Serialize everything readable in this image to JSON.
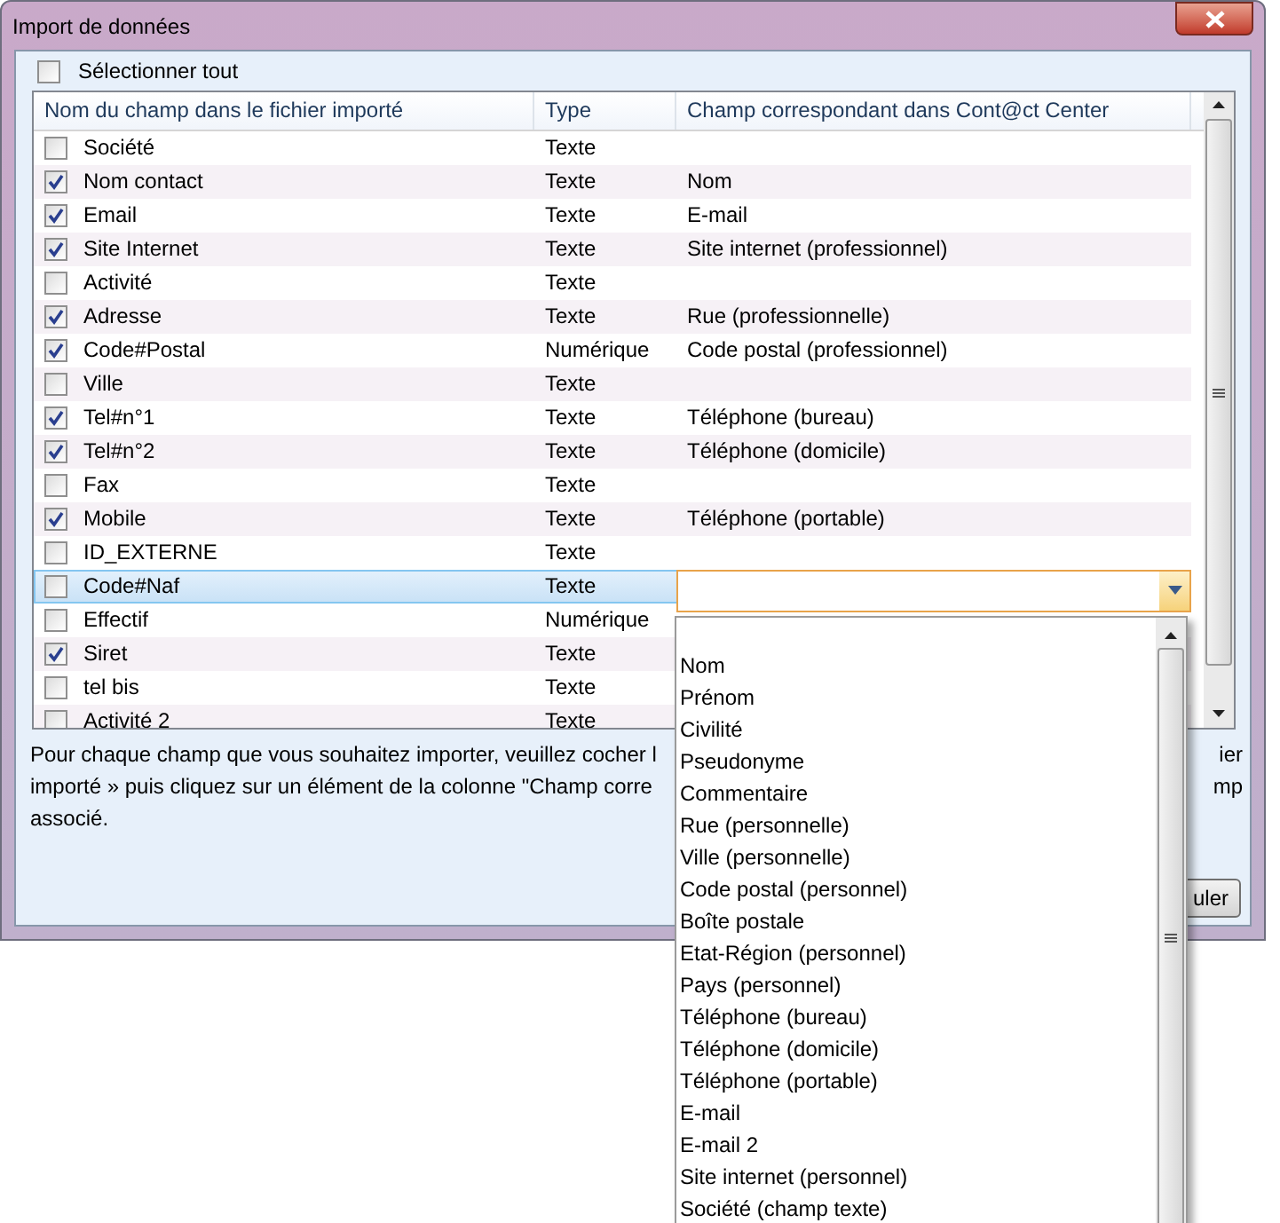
{
  "window": {
    "title": "Import de données"
  },
  "select_all": {
    "label": "Sélectionner tout",
    "checked": false
  },
  "table": {
    "columns": [
      "Nom du champ dans le fichier importé",
      "Type",
      "Champ correspondant dans Cont@ct Center"
    ],
    "rows": [
      {
        "checked": false,
        "name": "Société",
        "type": "Texte",
        "selected": false
      },
      {
        "checked": true,
        "name": "Nom contact",
        "type": "Texte",
        "field": "Nom",
        "selected": false
      },
      {
        "checked": true,
        "name": "Email",
        "type": "Texte",
        "field": "E-mail",
        "selected": false
      },
      {
        "checked": true,
        "name": "Site Internet",
        "type": "Texte",
        "field": "Site internet (professionnel)",
        "selected": false
      },
      {
        "checked": false,
        "name": "Activité",
        "type": "Texte",
        "selected": false
      },
      {
        "checked": true,
        "name": "Adresse",
        "type": "Texte",
        "field": "Rue (professionnelle)",
        "selected": false
      },
      {
        "checked": true,
        "name": "Code#Postal",
        "type": "Numérique",
        "field": "Code postal (professionnel)",
        "selected": false
      },
      {
        "checked": false,
        "name": "Ville",
        "type": "Texte",
        "selected": false
      },
      {
        "checked": true,
        "name": "Tel#n°1",
        "type": "Texte",
        "field": "Téléphone (bureau)",
        "selected": false
      },
      {
        "checked": true,
        "name": "Tel#n°2",
        "type": "Texte",
        "field": "Téléphone (domicile)",
        "selected": false
      },
      {
        "checked": false,
        "name": "Fax",
        "type": "Texte",
        "selected": false
      },
      {
        "checked": true,
        "name": "Mobile",
        "type": "Texte",
        "field": "Téléphone (portable)",
        "selected": false
      },
      {
        "checked": false,
        "name": "ID_EXTERNE",
        "type": "Texte",
        "selected": false
      },
      {
        "checked": false,
        "name": "Code#Naf",
        "type": "Texte",
        "selected": true
      },
      {
        "checked": false,
        "name": "Effectif",
        "type": "Numérique",
        "selected": false
      },
      {
        "checked": true,
        "name": "Siret",
        "type": "Texte",
        "selected": false
      },
      {
        "checked": false,
        "name": "tel bis",
        "type": "Texte",
        "selected": false
      },
      {
        "checked": false,
        "name": "Activité 2",
        "type": "Texte",
        "selected": false
      }
    ]
  },
  "instructions": [
    {
      "left": "Pour chaque champ que vous souhaitez importer, veuillez cocher l",
      "right": "ier"
    },
    {
      "left": "importé » puis cliquez sur un élément de la colonne \"Champ corre",
      "right": "mp"
    },
    {
      "left": "associé."
    }
  ],
  "button": "uler",
  "dropdown": {
    "items": [
      "Nom",
      "Prénom",
      "Civilité",
      "Pseudonyme",
      "Commentaire",
      "Rue (personnelle)",
      "Ville (personnelle)",
      "Code postal (personnel)",
      "Boîte postale",
      "Etat-Région (personnel)",
      "Pays (personnel)",
      "Téléphone (bureau)",
      "Téléphone (domicile)",
      "Téléphone (portable)",
      "E-mail",
      "E-mail 2",
      "Site internet (personnel)",
      "Société (champ texte)"
    ]
  }
}
